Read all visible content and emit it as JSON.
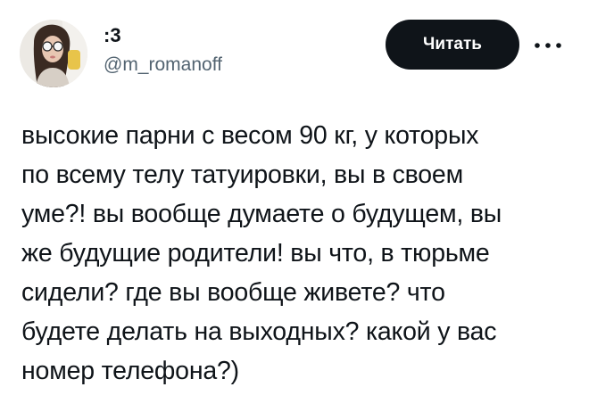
{
  "author": {
    "name": ":3",
    "handle": "@m_romanoff"
  },
  "actions": {
    "read_label": "Читать",
    "more_icon": "more-dots-icon"
  },
  "tweet": {
    "lines": [
      "высокие парни с весом 90 кг, у которых",
      "по всему телу татуировки, вы в своем",
      "уме?! вы вообще думаете о будущем, вы",
      "же будущие родители! вы что, в тюрьме",
      "сидели? где вы вообще живете? что",
      "будете делать на выходных? какой у вас",
      "номер телефона?)"
    ]
  },
  "colors": {
    "text": "#0f1419",
    "secondary_text": "#536471",
    "button_bg": "#0f1419",
    "button_text": "#ffffff",
    "background": "#ffffff"
  }
}
